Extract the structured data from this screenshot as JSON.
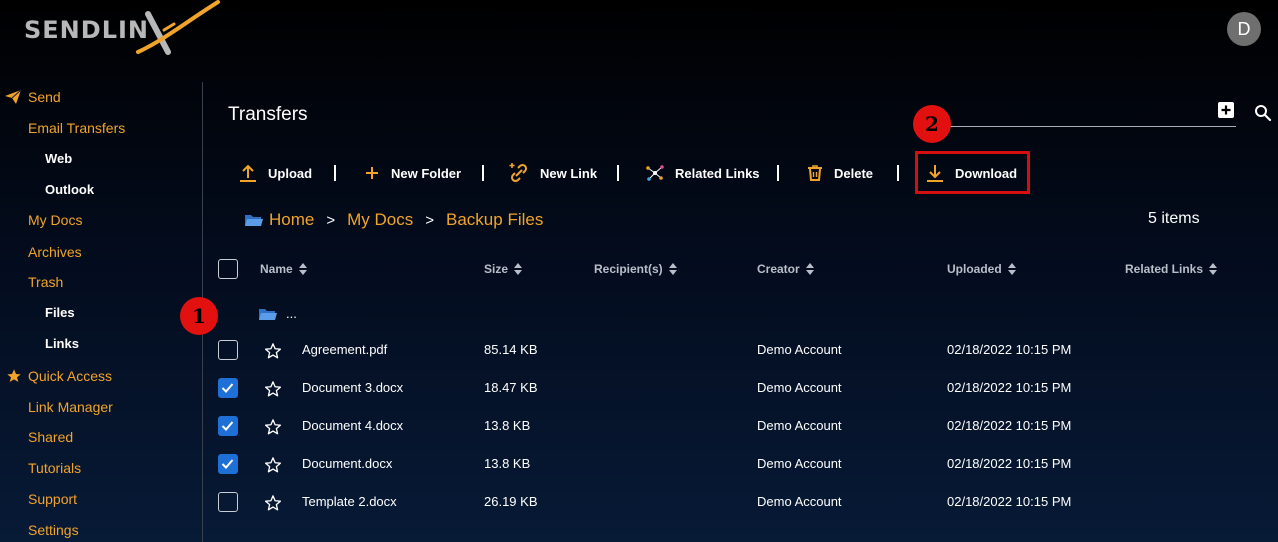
{
  "brand": {
    "name_prefix": "SENDLIN",
    "accent": "#f2a42a"
  },
  "user": {
    "initial": "D"
  },
  "sidebar": {
    "send": "Send",
    "email_transfers": "Email Transfers",
    "web": "Web",
    "outlook": "Outlook",
    "my_docs": "My Docs",
    "archives": "Archives",
    "trash": "Trash",
    "files": "Files",
    "links": "Links",
    "quick_access": "Quick Access",
    "link_manager": "Link Manager",
    "shared": "Shared",
    "tutorials": "Tutorials",
    "support": "Support",
    "settings": "Settings"
  },
  "header": {
    "title": "Transfers"
  },
  "toolbar": {
    "upload": "Upload",
    "new_folder": "New Folder",
    "new_link": "New Link",
    "related_links": "Related Links",
    "delete": "Delete",
    "download": "Download"
  },
  "annotations": {
    "marker1": "1",
    "marker2": "2",
    "highlight_color": "#d50f0f"
  },
  "breadcrumb": {
    "home": "Home",
    "my_docs": "My Docs",
    "current": "Backup Files",
    "separator": ">"
  },
  "item_count": "5 items",
  "table": {
    "columns": {
      "name": "Name",
      "size": "Size",
      "recipients": "Recipient(s)",
      "creator": "Creator",
      "uploaded": "Uploaded",
      "related_links": "Related Links"
    },
    "parent_folder": "...",
    "rows": [
      {
        "name": "Agreement.pdf",
        "size": "85.14 KB",
        "creator": "Demo Account",
        "uploaded": "02/18/2022 10:15 PM",
        "checked": false
      },
      {
        "name": "Document 3.docx",
        "size": "18.47 KB",
        "creator": "Demo Account",
        "uploaded": "02/18/2022 10:15 PM",
        "checked": true
      },
      {
        "name": "Document 4.docx",
        "size": "13.8 KB",
        "creator": "Demo Account",
        "uploaded": "02/18/2022 10:15 PM",
        "checked": true
      },
      {
        "name": "Document.docx",
        "size": "13.8 KB",
        "creator": "Demo Account",
        "uploaded": "02/18/2022 10:15 PM",
        "checked": true
      },
      {
        "name": "Template 2.docx",
        "size": "26.19 KB",
        "creator": "Demo Account",
        "uploaded": "02/18/2022 10:15 PM",
        "checked": false
      }
    ]
  }
}
